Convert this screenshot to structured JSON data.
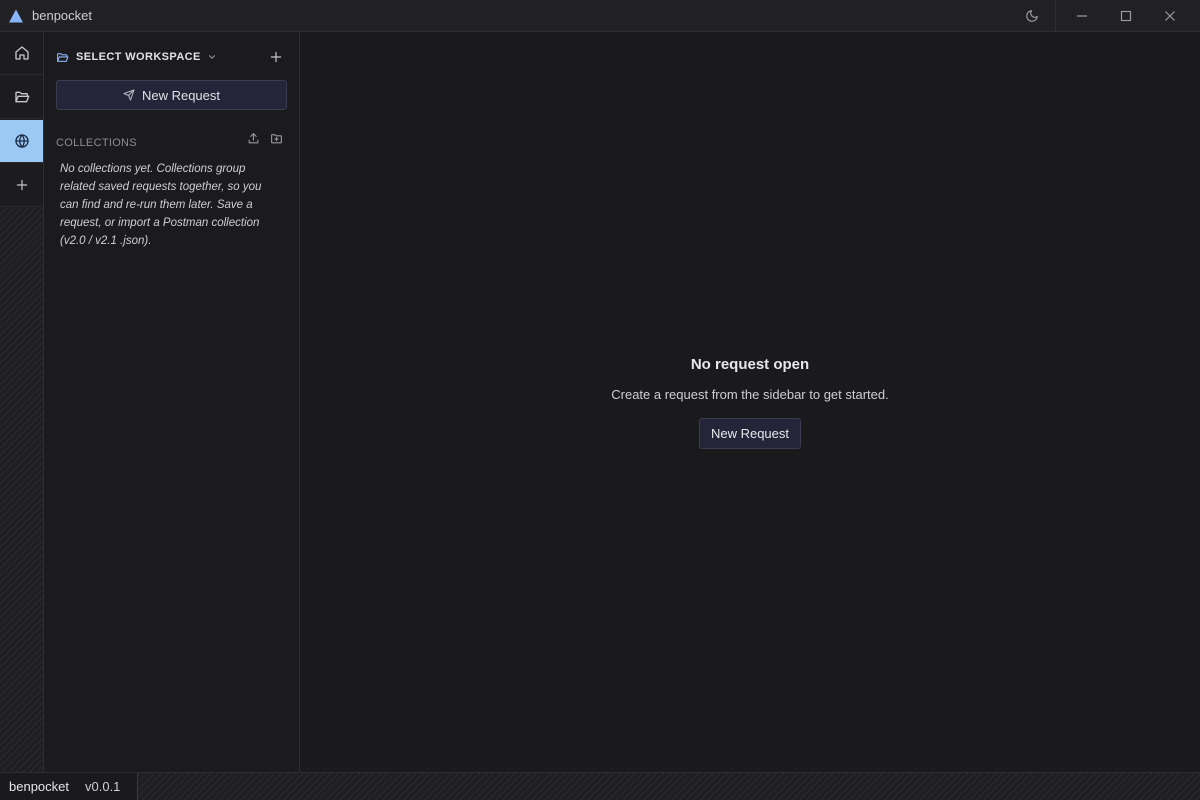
{
  "app": {
    "title": "benpocket",
    "accent_color": "#8ab4f8",
    "active_rail_color": "#9cc8f5"
  },
  "titlebar": {
    "icons": [
      "app-logo-icon",
      "moon-icon",
      "minimize-icon",
      "maximize-icon",
      "close-icon"
    ]
  },
  "rail": {
    "items": [
      {
        "icon": "home-icon",
        "active": false
      },
      {
        "icon": "folder-open-icon",
        "active": false
      },
      {
        "icon": "globe-icon",
        "active": true
      },
      {
        "icon": "plus-icon",
        "active": false
      }
    ]
  },
  "sidebar": {
    "workspace_label": "SELECT WORKSPACE",
    "new_request_label": "New Request",
    "collections_label": "COLLECTIONS",
    "collections_empty": "No collections yet. Collections group related saved requests together, so you can find and re-run them later. Save a request, or import a Postman collection (v2.0 / v2.1 .json)."
  },
  "main": {
    "empty_title": "No request open",
    "empty_subtitle": "Create a request from the sidebar to get started.",
    "new_request_label": "New Request"
  },
  "statusbar": {
    "app_name": "benpocket",
    "version": "v0.0.1"
  }
}
